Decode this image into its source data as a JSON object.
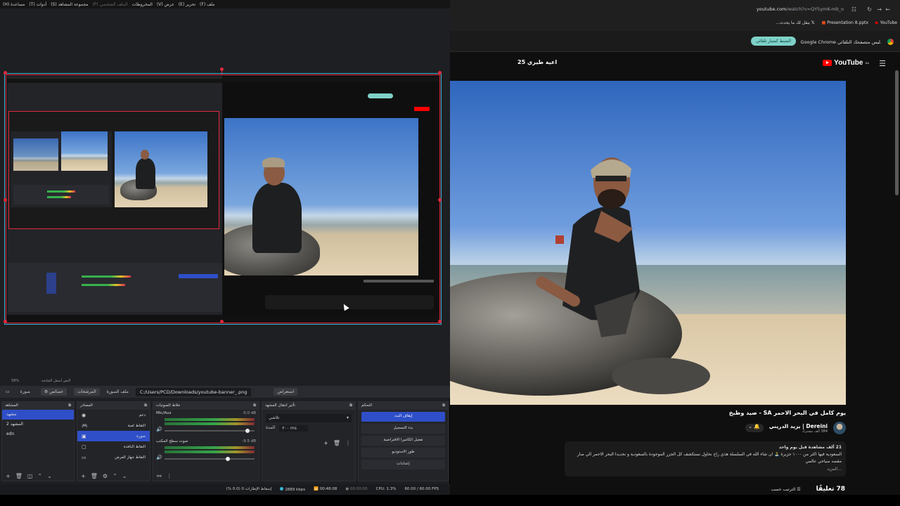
{
  "obs": {
    "menu": [
      "ملف (F)",
      "تحرير (E)",
      "عرض (V)",
      "الملف الشخصي (P)",
      "مجموعة المشاهد (S)",
      "أدوات (T)",
      "مساعدة (H)"
    ],
    "menu_extra": "المخروطات",
    "zoom_row": {
      "zoom": "58%",
      "text": "النص أسفل الشاشة"
    },
    "source_bar": {
      "filters": "فلاتر",
      "path_label": "ملف الصورة",
      "path": "C:/Users/PCD/Downloads/youtube-banner_.png",
      "browse": "استعراض",
      "properties": "خصائص",
      "filters_btn": "المرشحات",
      "scene_name": "صورة"
    },
    "scenes": {
      "title": "المشاهد",
      "items": [
        "مشهد",
        "المشهد 2",
        "edn"
      ]
    },
    "sources": {
      "title": "المصادر",
      "items": [
        "دعم",
        "التقاط لعبة",
        "صورة",
        "التقاط النافذة",
        "التقاط جهاز العرض"
      ]
    },
    "mixer": {
      "title": "خلاط الصوتيات",
      "channels": [
        {
          "name": "Mic/Aux",
          "db": "0.0 dB",
          "level": 0.92
        },
        {
          "name": "صوت سطح المكتب",
          "db": "-9.5 dB",
          "level": 0.7
        }
      ]
    },
    "transitions": {
      "title": "تأثير انتقال المشهد",
      "selected": "تلاشي",
      "duration_label": "المدة",
      "duration": "٣٠٠ ms"
    },
    "controls": {
      "title": "التحكم",
      "buttons": [
        "إيقاف البث",
        "بدء التسجيل",
        "تفعيل الكاميرا الافتراضية",
        "طور الاستوديو",
        "إعدادات"
      ]
    },
    "status": {
      "dropped": "إسقاط الإطارات 0 (0.0 %)",
      "kbps": "2889 kbps",
      "live": "00:48:08",
      "rec": "00:00:00",
      "cpu": "CPU: 1.3%",
      "fps": "60.00 / 60.00 FPS"
    }
  },
  "chrome": {
    "url_host": "youtube.com",
    "url_path": "/watch?v=QY5ymK-mb_o",
    "bookmarks": [
      "YouTube",
      "Presentation 8.pptx",
      "ينقل لك ما يحدث..."
    ],
    "infobar_text": "Google Chrome ليس متصفحك التلقائي.",
    "infobar_button": "الضبط كمتيار تلقائي"
  },
  "youtube": {
    "logo": "YouTube",
    "logo_region": "SA",
    "views_badge": "25 اعية طيري",
    "title": "يوم كامل في البحر الاحمر SA - صيد وطبخ",
    "channel": "Dereini | يزيد الدريني",
    "subs": "384 ألف مشترك",
    "description": {
      "views": "21 ألف مشاهدة قبل يوم واحد",
      "line1": "السعودية فيها اكثر من ١٠٠٠ جزيرة 🏝️ ان شاء الله في السلسلة هذي راح نحاول نستكشف كل الجزر الموجودة بالسعودية و نحديدا البحر الاحمر الي صار مقصد سياحي عالمي",
      "more": "...المزيد"
    },
    "comments_count": "78 تعليقًا",
    "sort_label": "الترتيب حسب"
  },
  "colors": {
    "accent": "#2f4fc9",
    "selection": "#e0293d",
    "yt_red": "#ff0000"
  }
}
